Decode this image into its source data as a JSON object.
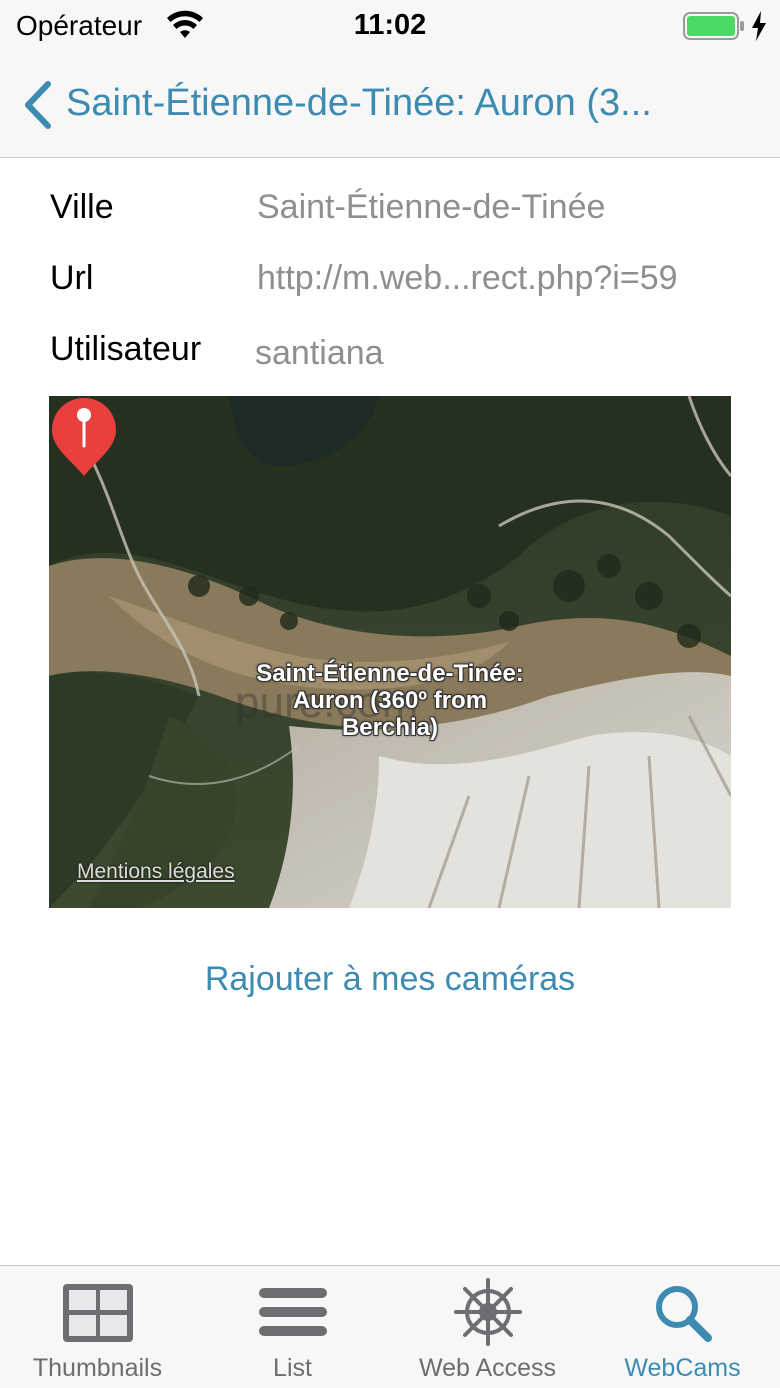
{
  "status_bar": {
    "carrier": "Opérateur",
    "time": "11:02",
    "battery_level": 1.0
  },
  "nav": {
    "title": "Saint-Étienne-de-Tinée: Auron (3..."
  },
  "details": [
    {
      "label": "Ville",
      "value": "Saint-Étienne-de-Tinée"
    },
    {
      "label": "Url",
      "value": "http://m.web...rect.php?i=59"
    },
    {
      "label": "Utilisateur",
      "value": "santiana"
    }
  ],
  "map": {
    "pin_label": "Saint-Étienne-de-Tinée: Auron (360º from Berchia)",
    "watermark": "pure.com",
    "legal_link": "Mentions légales",
    "pin_color": "#e9403d"
  },
  "actions": {
    "add_label": "Rajouter à mes caméras"
  },
  "tabs": [
    {
      "label": "Thumbnails",
      "icon": "grid-icon",
      "active": false
    },
    {
      "label": "List",
      "icon": "list-icon",
      "active": false
    },
    {
      "label": "Web Access",
      "icon": "ship-wheel-icon",
      "active": false
    },
    {
      "label": "WebCams",
      "icon": "search-icon",
      "active": true
    }
  ],
  "colors": {
    "accent": "#3d8bb1",
    "secondary_text": "#8e8e93",
    "tab_inactive": "#6d6d72",
    "battery_green": "#4cd964"
  }
}
